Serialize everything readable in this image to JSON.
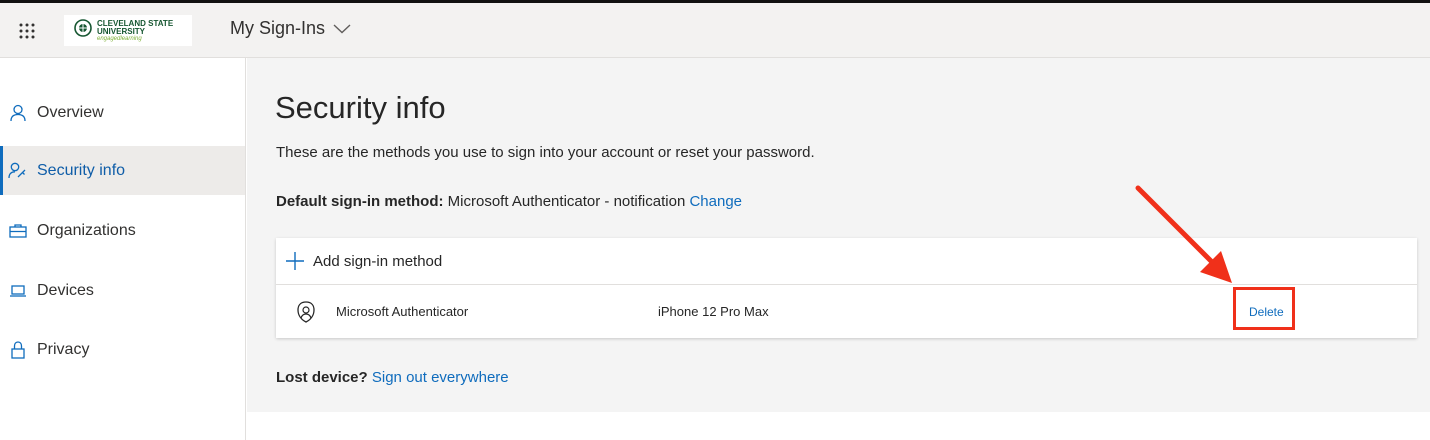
{
  "header": {
    "app_title": "My Sign-Ins",
    "logo": {
      "line1": "CLEVELAND STATE",
      "line2": "UNIVERSITY",
      "tagline": "engagedlearning"
    },
    "icons": {
      "launcher": "waffle-grid-icon",
      "title_dropdown": "chevron-down-icon"
    }
  },
  "sidebar": {
    "items": [
      {
        "label": "Overview",
        "icon": "person-icon"
      },
      {
        "label": "Security info",
        "icon": "person-key-icon",
        "active": true
      },
      {
        "label": "Organizations",
        "icon": "briefcase-icon"
      },
      {
        "label": "Devices",
        "icon": "laptop-icon"
      },
      {
        "label": "Privacy",
        "icon": "lock-icon"
      }
    ]
  },
  "main": {
    "title": "Security info",
    "description": "These are the methods you use to sign into your account or reset your password.",
    "default_method": {
      "label": "Default sign-in method:",
      "value": "Microsoft Authenticator - notification",
      "change_link": "Change"
    },
    "add_method_label": "Add sign-in method",
    "methods": [
      {
        "name": "Microsoft Authenticator",
        "detail": "iPhone 12 Pro Max",
        "action": "Delete",
        "icon": "authenticator-icon"
      }
    ],
    "lost_device": {
      "label": "Lost device?",
      "link": "Sign out everywhere"
    }
  },
  "annotation": {
    "color": "#f0301a"
  },
  "colors": {
    "accent": "#0f6cbd",
    "header_bg": "#f3f2f1",
    "main_bg": "#f4f4f4"
  }
}
